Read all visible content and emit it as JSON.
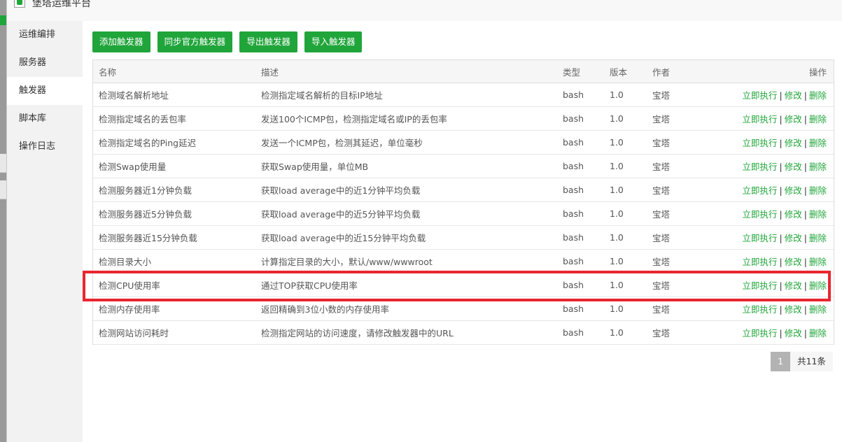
{
  "window": {
    "title": "堡塔运维平台"
  },
  "sidebar": {
    "items": [
      {
        "label": "运维编排"
      },
      {
        "label": "服务器"
      },
      {
        "label": "触发器"
      },
      {
        "label": "脚本库"
      },
      {
        "label": "操作日志"
      }
    ],
    "active": "触发器"
  },
  "toolbar": {
    "add_label": "添加触发器",
    "sync_label": "同步官方触发器",
    "export_label": "导出触发器",
    "import_label": "导入触发器"
  },
  "table": {
    "headers": {
      "name": "名称",
      "desc": "描述",
      "type": "类型",
      "version": "版本",
      "author": "作者",
      "actions": "操作"
    },
    "action_labels": {
      "run": "立即执行",
      "edit": "修改",
      "delete": "删除",
      "sep": "|"
    },
    "rows": [
      {
        "name": "检测域名解析地址",
        "desc": "检测指定域名解析的目标IP地址",
        "type": "bash",
        "version": "1.0",
        "author": "宝塔"
      },
      {
        "name": "检测指定域名的丢包率",
        "desc": "发送100个ICMP包，检测指定域名或IP的丢包率",
        "type": "bash",
        "version": "1.0",
        "author": "宝塔"
      },
      {
        "name": "检测指定域名的Ping延迟",
        "desc": "发送一个ICMP包，检测其延迟，单位毫秒",
        "type": "bash",
        "version": "1.0",
        "author": "宝塔"
      },
      {
        "name": "检测Swap使用量",
        "desc": "获取Swap使用量，单位MB",
        "type": "bash",
        "version": "1.0",
        "author": "宝塔"
      },
      {
        "name": "检测服务器近1分钟负载",
        "desc": "获取load average中的近1分钟平均负载",
        "type": "bash",
        "version": "1.0",
        "author": "宝塔"
      },
      {
        "name": "检测服务器近5分钟负载",
        "desc": "获取load average中的近5分钟平均负载",
        "type": "bash",
        "version": "1.0",
        "author": "宝塔"
      },
      {
        "name": "检测服务器近15分钟负载",
        "desc": "获取load average中的近15分钟平均负载",
        "type": "bash",
        "version": "1.0",
        "author": "宝塔"
      },
      {
        "name": "检测目录大小",
        "desc": "计算指定目录的大小，默认/www/wwwroot",
        "type": "bash",
        "version": "1.0",
        "author": "宝塔"
      },
      {
        "name": "检测CPU使用率",
        "desc": "通过TOP获取CPU使用率",
        "type": "bash",
        "version": "1.0",
        "author": "宝塔"
      },
      {
        "name": "检测内存使用率",
        "desc": "返回精确到3位小数的内存使用率",
        "type": "bash",
        "version": "1.0",
        "author": "宝塔"
      },
      {
        "name": "检测网站访问耗时",
        "desc": "检测指定网站的访问速度，请修改触发器中的URL",
        "type": "bash",
        "version": "1.0",
        "author": "宝塔"
      }
    ]
  },
  "pagination": {
    "current": "1",
    "total_label": "共11条"
  },
  "colors": {
    "accent": "#20a53a",
    "highlight": "#e8262f"
  },
  "icons": {
    "app_logo": "baota-logo-icon"
  }
}
